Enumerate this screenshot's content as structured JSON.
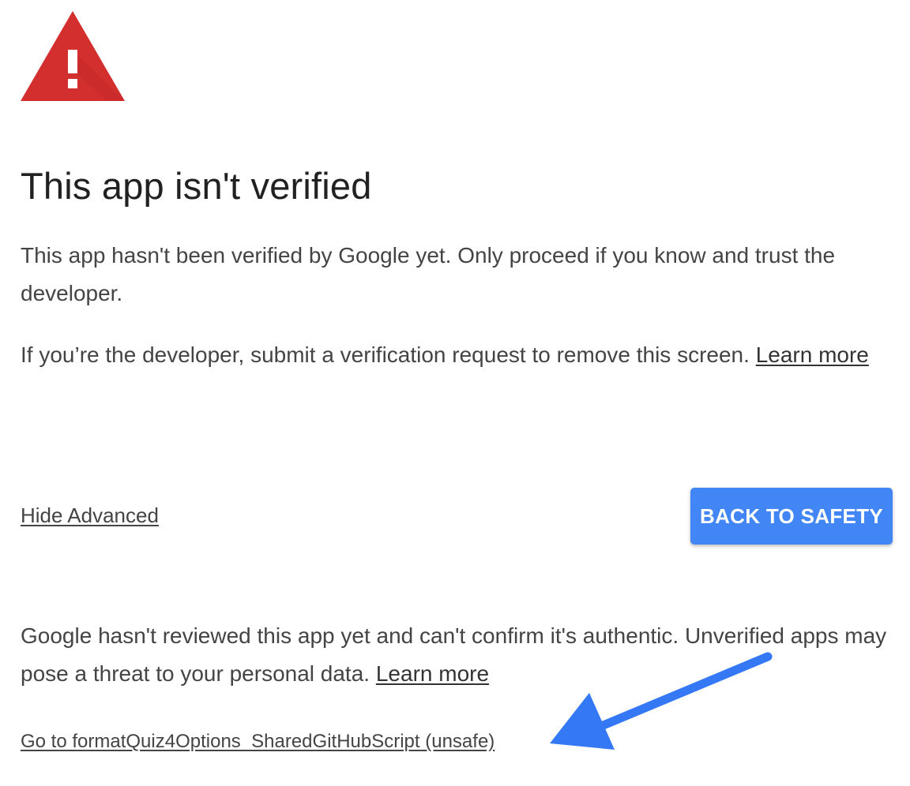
{
  "colors": {
    "warning_red": "#d32f2f",
    "primary_blue": "#4285f4",
    "annotation_arrow": "#3478f6"
  },
  "icons": {
    "warning": "warning-triangle-icon",
    "annotation": "annotation-arrow-icon"
  },
  "heading": "This app isn't verified",
  "intro": {
    "text": "This app hasn't been verified by Google yet. Only proceed if you know and trust the developer."
  },
  "developer_note": {
    "text": "If you’re the developer, submit a verification request to remove this screen. ",
    "link_label": "Learn more"
  },
  "actions": {
    "hide_advanced_label": "Hide Advanced",
    "back_to_safety_label": "BACK TO SAFETY"
  },
  "advanced": {
    "text": "Google hasn't reviewed this app yet and can't confirm it's authentic. Unverified apps may pose a threat to your personal data. ",
    "link_label": "Learn more",
    "unsafe_link_label": "Go to formatQuiz4Options_SharedGitHubScript (unsafe)"
  }
}
